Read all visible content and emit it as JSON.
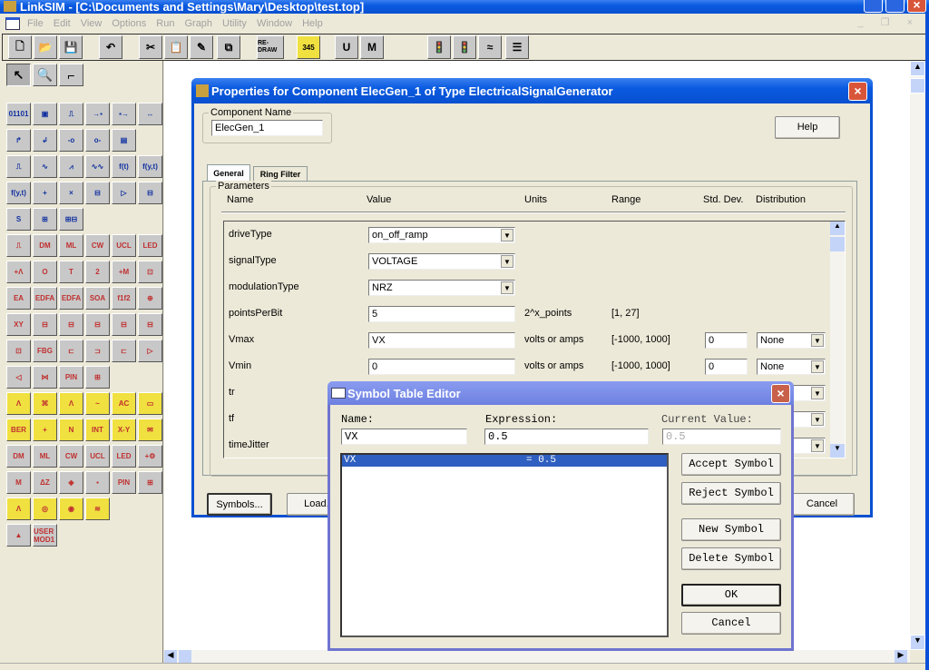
{
  "app": {
    "title": "LinkSIM - [C:\\Documents and Settings\\Mary\\Desktop\\test.top]",
    "menu": [
      "File",
      "Edit",
      "View",
      "Options",
      "Run",
      "Graph",
      "Utility",
      "Window",
      "Help"
    ],
    "toolbar": [
      {
        "icon": "new-file-icon",
        "g": "🗋"
      },
      {
        "icon": "open-folder-icon",
        "g": "📂"
      },
      {
        "icon": "save-icon",
        "g": "💾"
      },
      {
        "icon": "undo-icon",
        "g": "↶"
      },
      {
        "icon": "cut-icon",
        "g": "✂"
      },
      {
        "icon": "paste-icon",
        "g": "📋"
      },
      {
        "icon": "probe-icon",
        "g": "✎"
      },
      {
        "icon": "copy-icon",
        "g": "⧉"
      },
      {
        "icon": "redraw-icon",
        "g": "RE-DRAW"
      },
      {
        "icon": "sweep-icon",
        "g": "345"
      },
      {
        "icon": "user-manual-icon",
        "g": "U"
      },
      {
        "icon": "model-manual-icon",
        "g": "M"
      },
      {
        "icon": "run-signal-icon",
        "g": "🚦"
      },
      {
        "icon": "stop-signal-icon",
        "g": "🚦"
      },
      {
        "icon": "graph-icon",
        "g": "≈"
      },
      {
        "icon": "report-icon",
        "g": "☰"
      }
    ],
    "tools": [
      {
        "icon": "pointer-icon",
        "g": "↖"
      },
      {
        "icon": "zoom-icon",
        "g": "🔍"
      },
      {
        "icon": "wire-icon",
        "g": "⌐"
      }
    ],
    "palette": [
      "01101",
      "▣",
      "⎍",
      "→▪",
      "▪→",
      "↔",
      "↱",
      "↲",
      "-o",
      "o-",
      "▤",
      "",
      "⎍",
      "∿",
      "⩘",
      "∿∿",
      "f(t)",
      "f(y,t)",
      "f(y,t)",
      "+",
      "×",
      "⊟",
      "▷",
      "⊟",
      "S",
      "⊞",
      "⊞⊟",
      "",
      "",
      "",
      "⎍",
      "DM",
      "ML",
      "CW",
      "UCL",
      "LED",
      "+Λ",
      "O",
      "T",
      "2",
      "+M",
      "⊡",
      "EA",
      "EDFA",
      "EDFA",
      "SOA",
      "f1f2",
      "⊕",
      "XY",
      "⊟",
      "⊟",
      "⊟",
      "⊟",
      "⊟",
      "⊡",
      "FBG",
      "⊏",
      "⊐",
      "⊏",
      "▷",
      "◁",
      "⋈",
      "PIN",
      "⊞",
      "",
      "",
      "Λ",
      "⌘",
      "Λ",
      "~",
      "AC",
      "▭",
      "BER",
      "+",
      "N",
      "INT",
      "X-Y",
      "✉",
      "DM",
      "ML",
      "CW",
      "UCL",
      "LED",
      "+⚙",
      "M",
      "ΔZ",
      "◈",
      "▪",
      "PIN",
      "⊞",
      "Λ",
      "◎",
      "◉",
      "≋",
      "",
      "",
      "▲",
      "USER MOD1"
    ]
  },
  "properties": {
    "title": "Properties for Component ElecGen_1 of Type ElectricalSignalGenerator",
    "component_name_label": "Component Name",
    "component_name": "ElecGen_1",
    "help": "Help",
    "tabs": [
      "General",
      "Ring Filter"
    ],
    "active_tab": "General",
    "parameters_label": "Parameters",
    "headers": [
      "Name",
      "Value",
      "Units",
      "Range",
      "Std. Dev.",
      "Distribution"
    ],
    "rows": [
      {
        "name": "driveType",
        "value": "on_off_ramp",
        "type": "select",
        "units": "",
        "range": "",
        "std": "",
        "dist": ""
      },
      {
        "name": "signalType",
        "value": "VOLTAGE",
        "type": "select",
        "units": "",
        "range": "",
        "std": "",
        "dist": ""
      },
      {
        "name": "modulationType",
        "value": "NRZ",
        "type": "select",
        "units": "",
        "range": "",
        "std": "",
        "dist": ""
      },
      {
        "name": "pointsPerBit",
        "value": "5",
        "type": "text",
        "units": "2^x_points",
        "range": "[1, 27]",
        "std": "",
        "dist": ""
      },
      {
        "name": "Vmax",
        "value": "VX",
        "type": "text",
        "units": "volts or amps",
        "range": "[-1000, 1000]",
        "std": "0",
        "dist": "None"
      },
      {
        "name": "Vmin",
        "value": "0",
        "type": "text",
        "units": "volts or amps",
        "range": "[-1000, 1000]",
        "std": "0",
        "dist": "None"
      },
      {
        "name": "tr",
        "value": "",
        "type": "text",
        "units": "",
        "range": "",
        "std": "",
        "dist": " "
      },
      {
        "name": "tf",
        "value": "",
        "type": "text",
        "units": "",
        "range": "",
        "std": "",
        "dist": " "
      },
      {
        "name": "timeJitter",
        "value": "",
        "type": "text",
        "units": "",
        "range": "",
        "std": "",
        "dist": " "
      }
    ],
    "symbols": "Symbols...",
    "load": "Load...",
    "cancel": "Cancel"
  },
  "symbol_editor": {
    "title": "Symbol Table Editor",
    "name_label": "Name:",
    "expr_label": "Expression:",
    "current_label": "Current Value:",
    "name": "VX",
    "expression": "0.5",
    "current": "0.5",
    "list": [
      {
        "name": "VX",
        "value": "= 0.5",
        "selected": true
      }
    ],
    "accept": "Accept Symbol",
    "reject": "Reject Symbol",
    "new": "New Symbol",
    "delete": "Delete Symbol",
    "ok": "OK",
    "cancel": "Cancel"
  }
}
